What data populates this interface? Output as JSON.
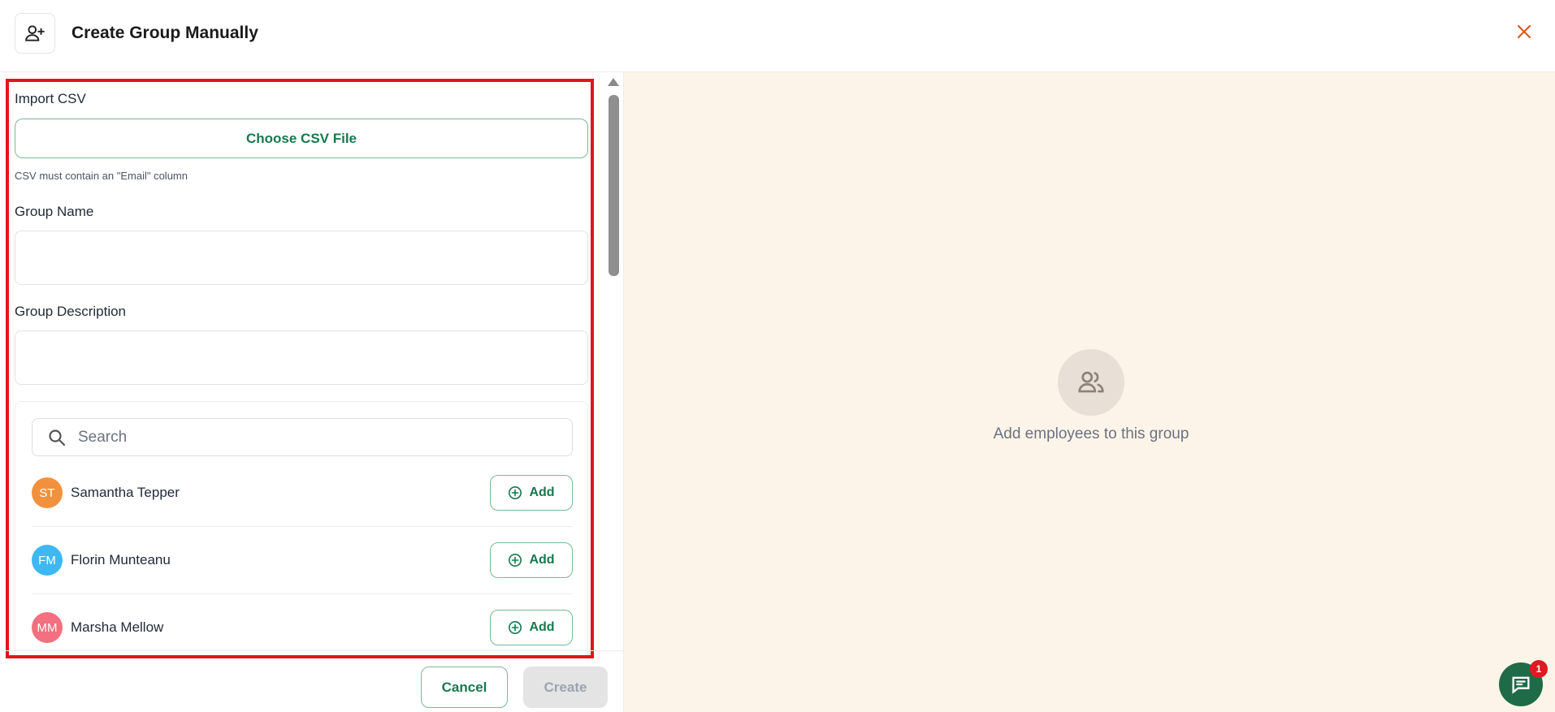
{
  "header": {
    "title": "Create Group Manually",
    "icon": "user-plus-icon",
    "close_icon": "close-icon",
    "close_color": "#e05a1a"
  },
  "form": {
    "import_label": "Import CSV",
    "csv_button": "Choose CSV File",
    "csv_hint": "CSV must contain an \"Email\" column",
    "group_name_label": "Group Name",
    "group_name_value": "",
    "group_description_label": "Group Description",
    "group_description_value": ""
  },
  "employees": {
    "search_placeholder": "Search",
    "add_label": "Add",
    "items": [
      {
        "initials": "ST",
        "name": "Samantha Tepper",
        "color": "#f2913d"
      },
      {
        "initials": "FM",
        "name": "Florin Munteanu",
        "color": "#3db8f2"
      },
      {
        "initials": "MM",
        "name": "Marsha Mellow",
        "color": "#f2707f"
      }
    ]
  },
  "footer": {
    "cancel_label": "Cancel",
    "create_label": "Create"
  },
  "empty_state": {
    "icon": "users-icon",
    "text": "Add employees to this group"
  },
  "chat": {
    "icon": "chat-icon",
    "badge": "1"
  },
  "colors": {
    "accent": "#17794d",
    "highlight": "#e3141b",
    "right_panel_bg": "#fdf4e9"
  }
}
